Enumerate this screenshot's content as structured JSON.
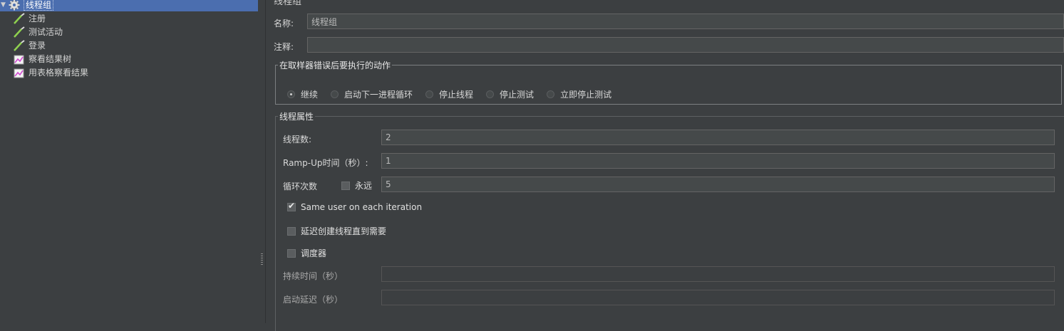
{
  "tree": {
    "root": {
      "label": "线程组",
      "expanded": true
    },
    "items": [
      {
        "label": "注册",
        "icon": "pipette-icon"
      },
      {
        "label": "测试活动",
        "icon": "pipette-icon"
      },
      {
        "label": "登录",
        "icon": "pipette-icon"
      },
      {
        "label": "察看结果树",
        "icon": "chart-icon"
      },
      {
        "label": "用表格察看结果",
        "icon": "chart-icon"
      }
    ]
  },
  "panel": {
    "title": "线程组",
    "name_label": "名称:",
    "name_value": "线程组",
    "comment_label": "注释:",
    "comment_value": "",
    "error_action": {
      "legend": "在取样器错误后要执行的动作",
      "options": [
        "继续",
        "启动下一进程循环",
        "停止线程",
        "停止测试",
        "立即停止测试"
      ],
      "selected": "继续"
    },
    "thread_props": {
      "legend": "线程属性",
      "threads_label": "线程数:",
      "threads_value": "2",
      "rampup_label": "Ramp-Up时间（秒）:",
      "rampup_value": "1",
      "loop_label": "循环次数",
      "forever_label": "永远",
      "forever_checked": false,
      "loop_value": "5",
      "same_user_label": "Same user on each iteration",
      "same_user_checked": true,
      "delay_create_label": "延迟创建线程直到需要",
      "delay_create_checked": false,
      "scheduler_label": "调度器",
      "scheduler_checked": false,
      "duration_label": "持续时间（秒）",
      "duration_value": "",
      "startup_delay_label": "启动延迟（秒）",
      "startup_delay_value": ""
    }
  },
  "colors": {
    "background": "#3c3f41",
    "selection": "#4b6eaf",
    "field_bg": "#45494a"
  }
}
